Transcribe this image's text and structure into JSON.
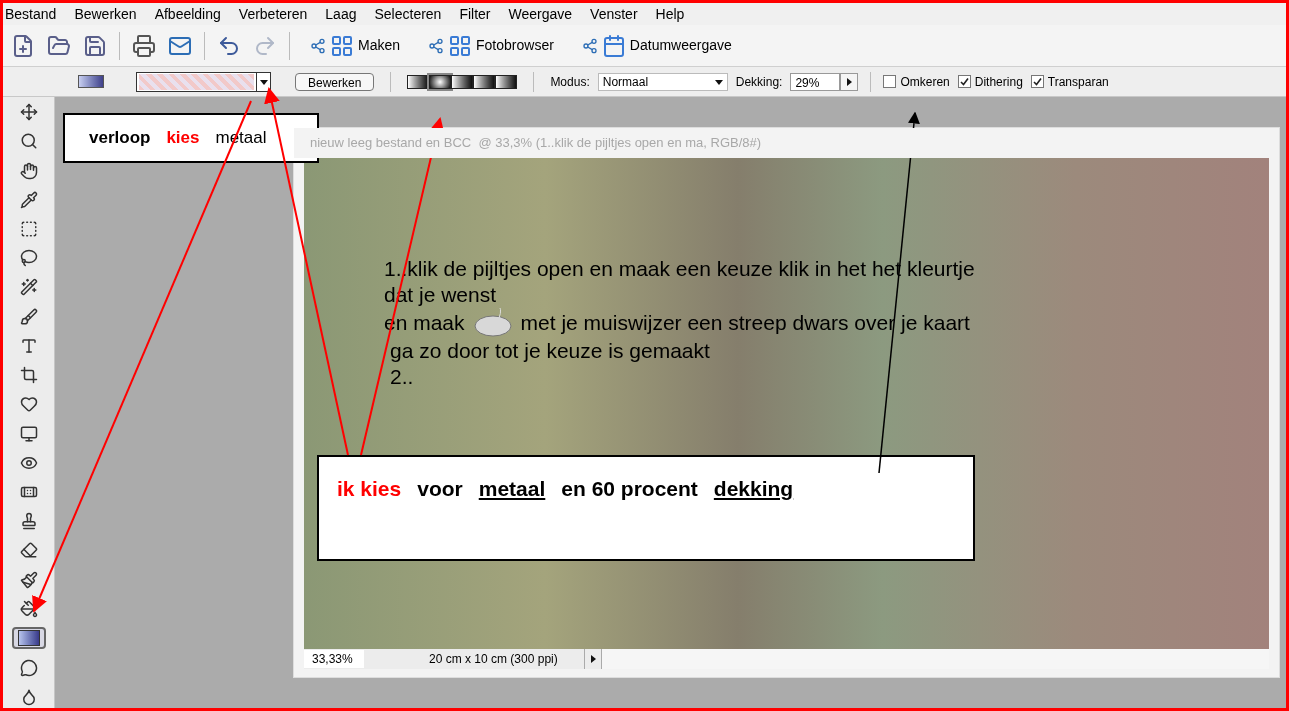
{
  "menu": [
    "Bestand",
    "Bewerken",
    "Afbeelding",
    "Verbeteren",
    "Laag",
    "Selecteren",
    "Filter",
    "Weergave",
    "Venster",
    "Help"
  ],
  "toolbar": {
    "actions": [
      "Maken",
      "Fotobrowser",
      "Datumweergave"
    ]
  },
  "options": {
    "edit_button": "Bewerken",
    "gradient_styles": [
      {
        "selected": false
      },
      {
        "selected": true
      },
      {
        "selected": false
      },
      {
        "selected": false
      },
      {
        "selected": false
      }
    ],
    "mode_label": "Modus:",
    "mode_value": "Normaal",
    "opacity_label": "Dekking:",
    "opacity_value": "29%",
    "checkboxes": [
      {
        "label": "Omkeren",
        "checked": false
      },
      {
        "label": "Dithering",
        "checked": true
      },
      {
        "label": "Transparan",
        "checked": true
      }
    ]
  },
  "tools": [
    {
      "selected": false
    },
    {
      "selected": false
    },
    {
      "selected": false
    },
    {
      "selected": false
    },
    {
      "selected": false
    },
    {
      "selected": false
    },
    {
      "selected": false
    },
    {
      "selected": false
    },
    {
      "selected": false
    },
    {
      "selected": false
    },
    {
      "selected": false
    },
    {
      "selected": false
    },
    {
      "selected": false
    },
    {
      "selected": false
    },
    {
      "selected": false
    },
    {
      "selected": false
    },
    {
      "selected": false
    },
    {
      "selected": false
    },
    {
      "selected": true
    },
    {
      "selected": false
    },
    {
      "selected": false
    }
  ],
  "document": {
    "title": "nieuw leeg bestand en BCC  @ 33,3% (1..klik de pijltjes open en ma, RGB/8#)",
    "lines": [
      "1..klik de pijltjes open en maak een keuze klik in het het kleurtje",
      "dat je wenst"
    ],
    "line_before_mouse": "en maak",
    "line_after_mouse": "met je muiswijzer een streep dwars over je kaart",
    "lines_after": [
      "ga zo door tot je keuze is gemaakt",
      "2.."
    ],
    "zoom": "33,33%",
    "size": "20 cm x 10 cm (300 ppi)"
  },
  "annotations": [
    {
      "parts": [
        {
          "text": "verloop",
          "kind": "bold"
        },
        {
          "text": "kies",
          "kind": "highlight"
        },
        {
          "text": "metaal",
          "kind": "plain"
        }
      ]
    },
    {
      "parts": [
        {
          "text": "ik kies",
          "kind": "highlight"
        },
        {
          "text": "voor",
          "kind": "bold"
        },
        {
          "text": "metaal",
          "kind": "underline"
        },
        {
          "text": "en 60 procent",
          "kind": "bold"
        },
        {
          "text": "dekking",
          "kind": "underline"
        }
      ]
    }
  ]
}
